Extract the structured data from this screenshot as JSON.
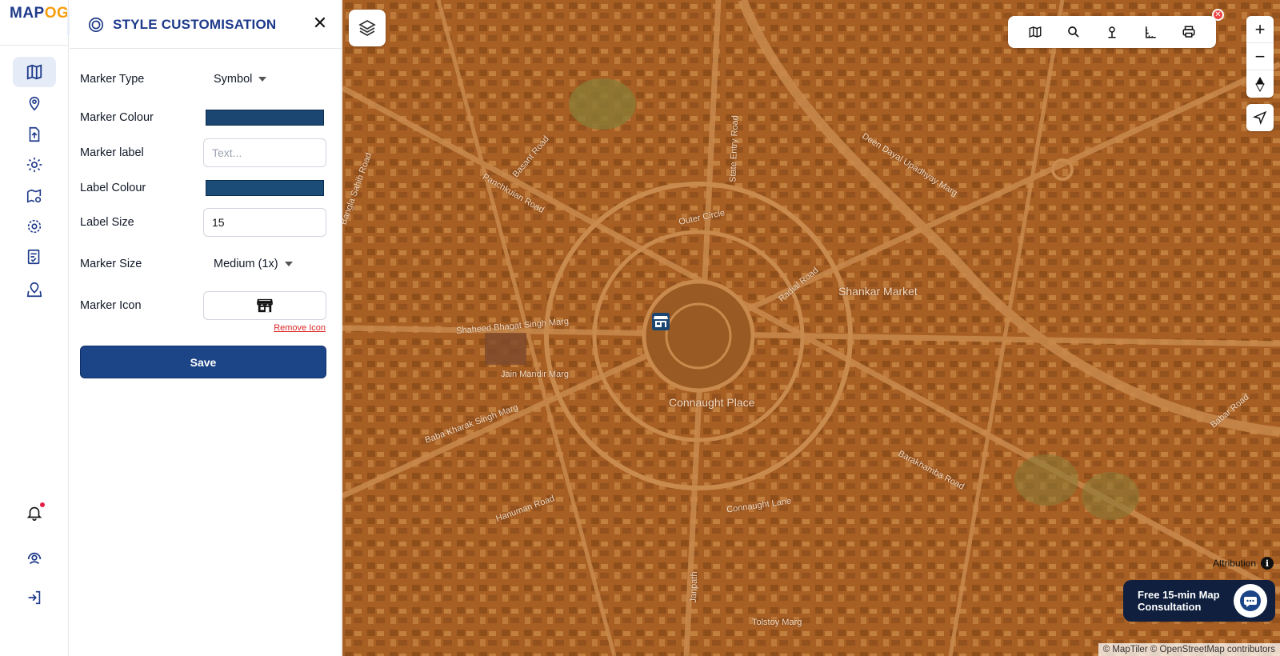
{
  "brand": {
    "logo_text_a": "MAP",
    "logo_text_b": "OG"
  },
  "rail": {
    "items": [
      {
        "name": "map-icon",
        "active": true
      },
      {
        "name": "location-pin-icon"
      },
      {
        "name": "upload-icon"
      },
      {
        "name": "gear-icon"
      },
      {
        "name": "map-edit-icon"
      },
      {
        "name": "settings-icon"
      },
      {
        "name": "form-checklist-icon"
      },
      {
        "name": "map-locate-icon"
      }
    ],
    "bottom": [
      {
        "name": "bell-icon"
      },
      {
        "name": "user-support-icon"
      },
      {
        "name": "logout-icon"
      }
    ]
  },
  "panel": {
    "title": "STYLE CUSTOMISATION",
    "fields": {
      "marker_type": {
        "label": "Marker Type",
        "value": "Symbol"
      },
      "marker_colour": {
        "label": "Marker Colour",
        "color": "#1b4672"
      },
      "marker_label": {
        "label": "Marker label",
        "value": "",
        "placeholder": "Text..."
      },
      "label_colour": {
        "label": "Label Colour",
        "color": "#1b4c78"
      },
      "label_size": {
        "label": "Label Size",
        "value": "15"
      },
      "marker_size": {
        "label": "Marker Size",
        "value": "Medium (1x)"
      },
      "marker_icon": {
        "label": "Marker Icon",
        "icon": "store-icon",
        "remove_label": "Remove Icon"
      }
    },
    "save_label": "Save"
  },
  "map": {
    "labels": {
      "shankar_market": "Shankar Market",
      "connaught_place": "Connaught Place",
      "outer_circle": "Outer Circle",
      "shaheed_bhagat_singh_marg": "Shaheed Bhagat Singh Marg",
      "jain_mandir_marg": "Jain Mandir Marg",
      "baba_kharak_singh_marg": "Baba Kharak Singh Marg",
      "hanuman_road": "Hanuman Road",
      "connaught_lane": "Connaught Lane",
      "tolstoy_marg": "Tolstoy Marg",
      "barakhamba_road": "Barakhamba Road",
      "janpath": "Janpath",
      "state_entry_road": "State Entry Road",
      "basant_road": "Basant Road",
      "panchkuian_road": "Panchkuian Road",
      "bangla_sahib_road": "Bangla Sahib Road",
      "babar_road": "Babar Road",
      "radial_road": "Radial Road",
      "deen_dayal": "Deen Dayal Upadhyay Marg"
    },
    "toolbar": [
      "map-view-icon",
      "search-icon",
      "pin-icon",
      "measure-icon",
      "print-icon"
    ],
    "zoom_in": "+",
    "zoom_out": "−",
    "attribution": "Attribution",
    "consult_text": "Free 15-min Map Consultation",
    "copyright": "© MapTiler © OpenStreetMap contributors",
    "colors": {
      "base": "#b0682a",
      "road": "#c98a4d",
      "block": "#8e4f1c"
    }
  }
}
